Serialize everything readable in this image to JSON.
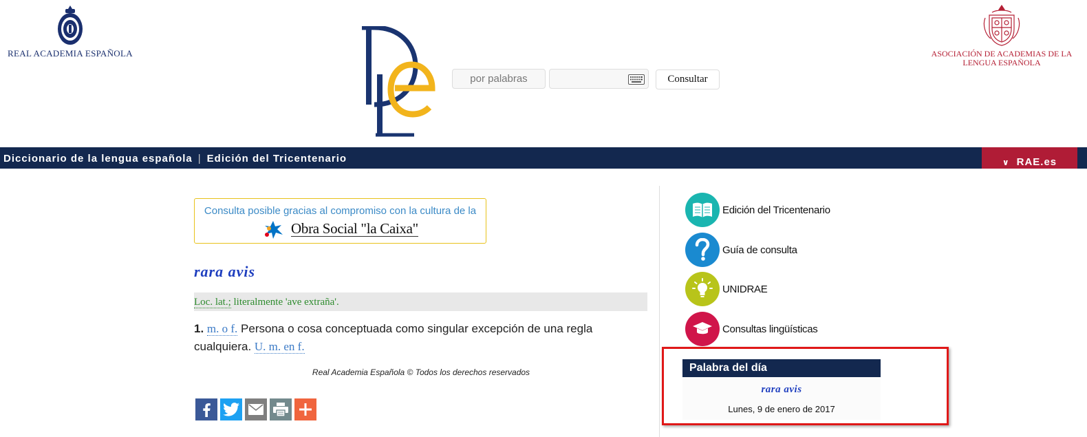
{
  "header": {
    "rae_label": "REAL ACADEMIA ESPAÑOLA",
    "asale_label": "ASOCIACIÓN DE ACADEMIAS DE LA LENGUA ESPAÑOLA",
    "dle_logo_letters": "DLE"
  },
  "search": {
    "mode": "por palabras",
    "input_value": "",
    "button_label": "Consultar"
  },
  "navbar": {
    "title": "Diccionario de la lengua española",
    "separator": "|",
    "edition": "Edición del Tricentenario",
    "rae_link": "RAE.es"
  },
  "sponsor": {
    "text": "Consulta posible gracias al compromiso con la cultura de la",
    "brand": "Obra Social \"la Caixa\""
  },
  "entry": {
    "word": "rara avis",
    "etymology": {
      "abbr": "Loc. lat.;",
      "text": " literalmente 'ave extraña'."
    },
    "definition": {
      "number": "1.",
      "category": "m. o f.",
      "text": " Persona o cosa conceptuada como singular excepción de una regla cualquiera. ",
      "usage": "U. m. en f."
    },
    "copyright": "Real Academia Española © Todos los derechos reservados"
  },
  "share": [
    {
      "name": "facebook",
      "icon": "facebook-icon",
      "color": "#3b5998"
    },
    {
      "name": "twitter",
      "icon": "twitter-icon",
      "color": "#1da1f2"
    },
    {
      "name": "email",
      "icon": "email-icon",
      "color": "#7f7f7f"
    },
    {
      "name": "print",
      "icon": "print-icon",
      "color": "#738a8d"
    },
    {
      "name": "more",
      "icon": "plus-icon",
      "color": "#f0653e"
    }
  ],
  "menu": [
    {
      "label": "Edición del Tricentenario",
      "icon": "book-icon",
      "color": "#1ab5b0"
    },
    {
      "label": "Guía de consulta",
      "icon": "question-icon",
      "color": "#1a8ad0"
    },
    {
      "label": "UNIDRAE",
      "icon": "lightbulb-icon",
      "color": "#b8c41a"
    },
    {
      "label": "Consultas lingüísticas",
      "icon": "graduation-cap-icon",
      "color": "#d0154a"
    }
  ],
  "word_of_day": {
    "title": "Palabra del día",
    "word": "rara avis",
    "date": "Lunes, 9 de enero de 2017"
  },
  "colors": {
    "navy": "#13284f",
    "rae_red": "#b01c36",
    "highlight_frame": "#e01818",
    "dle_blue": "#1a3470",
    "dle_yellow": "#f2b41c"
  }
}
